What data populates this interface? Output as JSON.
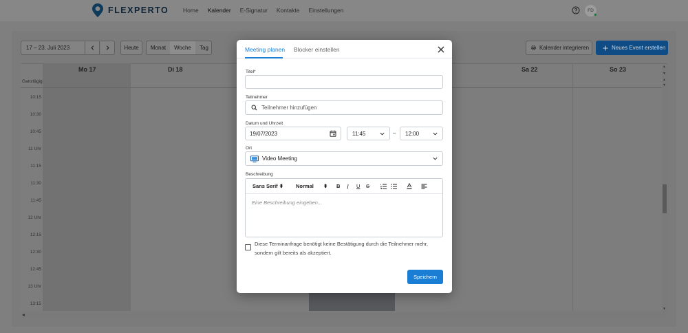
{
  "brand": {
    "name": "FLEXPERTO"
  },
  "nav": {
    "items": [
      "Home",
      "Kalender",
      "E-Signatur",
      "Kontakte",
      "Einstellungen"
    ]
  },
  "user": {
    "initials": "FD"
  },
  "toolbar": {
    "date_range": "17 – 23. Juli 2023",
    "today": "Heute",
    "views": [
      "Monat",
      "Woche",
      "Tag"
    ],
    "integrate": "Kalender integrieren",
    "create": "Neues Event erstellen"
  },
  "calendar": {
    "days": [
      "Mo 17",
      "Di 18",
      "Sa 22",
      "So 23"
    ],
    "allday_label": "Ganztägig",
    "times": [
      "10:15",
      "10:30",
      "10:45",
      "11 Uhr",
      "11:15",
      "11:30",
      "11:45",
      "12 Uhr",
      "12:15",
      "12:30",
      "12:45",
      "13 Uhr",
      "13:15"
    ]
  },
  "modal": {
    "tabs": [
      "Meeting planen",
      "Blocker einstellen"
    ],
    "title_label": "Titel*",
    "title_value": "",
    "attendees_label": "Teilnehmer",
    "attendees_placeholder": "Teilnehmer hinzufügen",
    "datetime_label": "Datum und Uhrzeit",
    "date_value": "19/07/2023",
    "start_time": "11:45",
    "end_time": "12:00",
    "dash": "–",
    "location_label": "Ort",
    "location_value": "Video Meeting",
    "description_label": "Beschreibung",
    "editor_font": "Sans Serif",
    "editor_size": "Normal",
    "description_placeholder": "Eine Beschreibung eingeben...",
    "checkbox_text": "Diese Terminanfrage benötigt keine Bestätigung durch die Teilnehmer mehr, sondern gilt bereits als akzeptiert.",
    "save": "Speichern"
  },
  "colors": {
    "accent": "#1a7fd4",
    "overlay": "#7f7f7f"
  }
}
